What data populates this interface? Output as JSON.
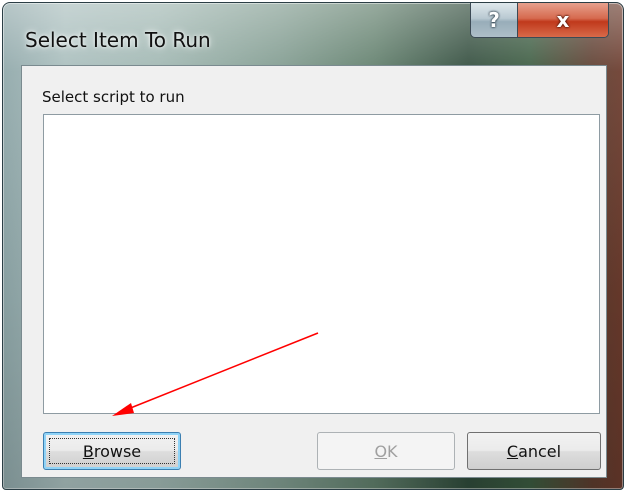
{
  "window": {
    "title": "Select Item To Run"
  },
  "caption_buttons": {
    "help": "?",
    "close": "x"
  },
  "dialog": {
    "prompt": "Select script to run",
    "script_list_items": []
  },
  "buttons": {
    "browse": {
      "accel": "B",
      "rest": "rowse"
    },
    "ok": {
      "accel": "O",
      "rest": "K",
      "enabled": false
    },
    "cancel": {
      "accel": "C",
      "rest": "ancel"
    }
  },
  "annotation": {
    "arrow_color": "#ff0000",
    "points_to": "browse-button"
  },
  "colors": {
    "close_button": "#c0391c",
    "focus_glow": "#8fd3f7",
    "disabled_text": "#a0a0a0"
  }
}
